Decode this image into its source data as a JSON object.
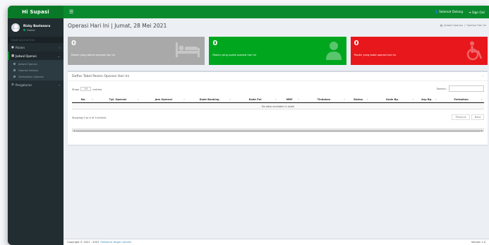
{
  "topbar": {
    "brand": "Hi Supasi",
    "toggle_icon": "bars-icon",
    "right_items": [
      "Selamat Datang",
      "Sign Out"
    ]
  },
  "sidebar": {
    "user_name": "Ricky Bastanaru",
    "user_status": "Online",
    "menu_header": "MAIN NAVIGATION",
    "items": [
      {
        "label": "Pasien"
      },
      {
        "label": "Jadwal Operasi"
      }
    ],
    "submenu": [
      {
        "label": "Jadwal Operasi"
      },
      {
        "label": "Operasi Selesai"
      },
      {
        "label": "Tambahkan Operasi"
      }
    ],
    "bottom_item": "Pengaturan"
  },
  "page": {
    "title": "Operasi Hari Ini | Jumat, 28 Mei 2021",
    "breadcrumb": [
      "Jadwal Operasi",
      "Operasi Hari Ini"
    ]
  },
  "cards": [
    {
      "value": "0",
      "desc": "Pasien yang belum operasi hari ini",
      "color": "#a9a9a9",
      "icon": "bed-icon"
    },
    {
      "value": "0",
      "desc": "Pasien yang sudah operasi hari ini",
      "color": "#00a71e",
      "icon": "doctor-icon"
    },
    {
      "value": "0",
      "desc": "Pasien yang batal operasi hari ini",
      "color": "#e8171b",
      "icon": "wheelchair-icon"
    }
  ],
  "table_box": {
    "title": "Daftar Tabel Pasien Operasi Hari Ini",
    "length_prefix": "Show",
    "length_value": "10",
    "length_suffix": "entries",
    "search_label": "Search:",
    "columns": [
      "No.",
      "Tgl. Operasi",
      "Jam Operasi",
      "Kode Booking",
      "Kode Pol",
      "MRP",
      "Tindakan",
      "Status",
      "Kode Bp.",
      "Asp Bp.",
      "Perbaikan"
    ],
    "empty_text": "No data available in table",
    "info_text": "Showing 0 to 0 of 0 entries",
    "prev_label": "Previous",
    "next_label": "Next"
  },
  "footer": {
    "copyright": "Copyright © 2021 - 2022",
    "link": "Politeknik Negeri Jember",
    "version": "Version 1.0"
  }
}
